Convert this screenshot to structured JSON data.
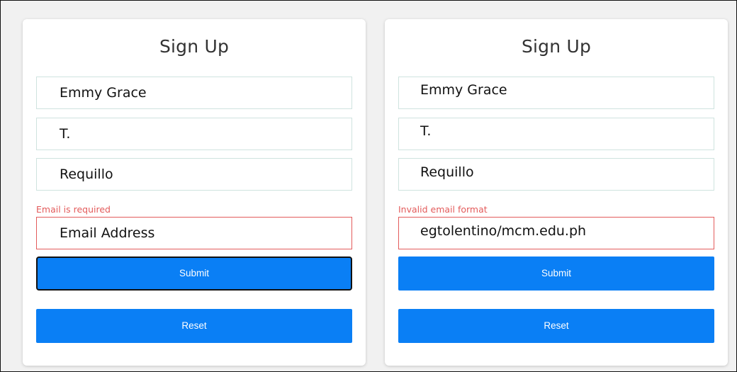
{
  "forms": [
    {
      "title": "Sign Up",
      "first_name": "Emmy Grace",
      "middle_initial": "T.",
      "last_name": "Requillo",
      "email_error": "Email is required",
      "email_value": "Email Address",
      "submit_label": "Submit",
      "reset_label": "Reset"
    },
    {
      "title": "Sign Up",
      "first_name": "Emmy Grace",
      "middle_initial": "T.",
      "last_name": "Requillo",
      "email_error": "Invalid email format",
      "email_value": "egtolentino/mcm.edu.ph",
      "submit_label": "Submit",
      "reset_label": "Reset"
    }
  ],
  "colors": {
    "primary": "#0a7ff5",
    "error": "#e35b5b",
    "field_border": "#cfe3df"
  }
}
